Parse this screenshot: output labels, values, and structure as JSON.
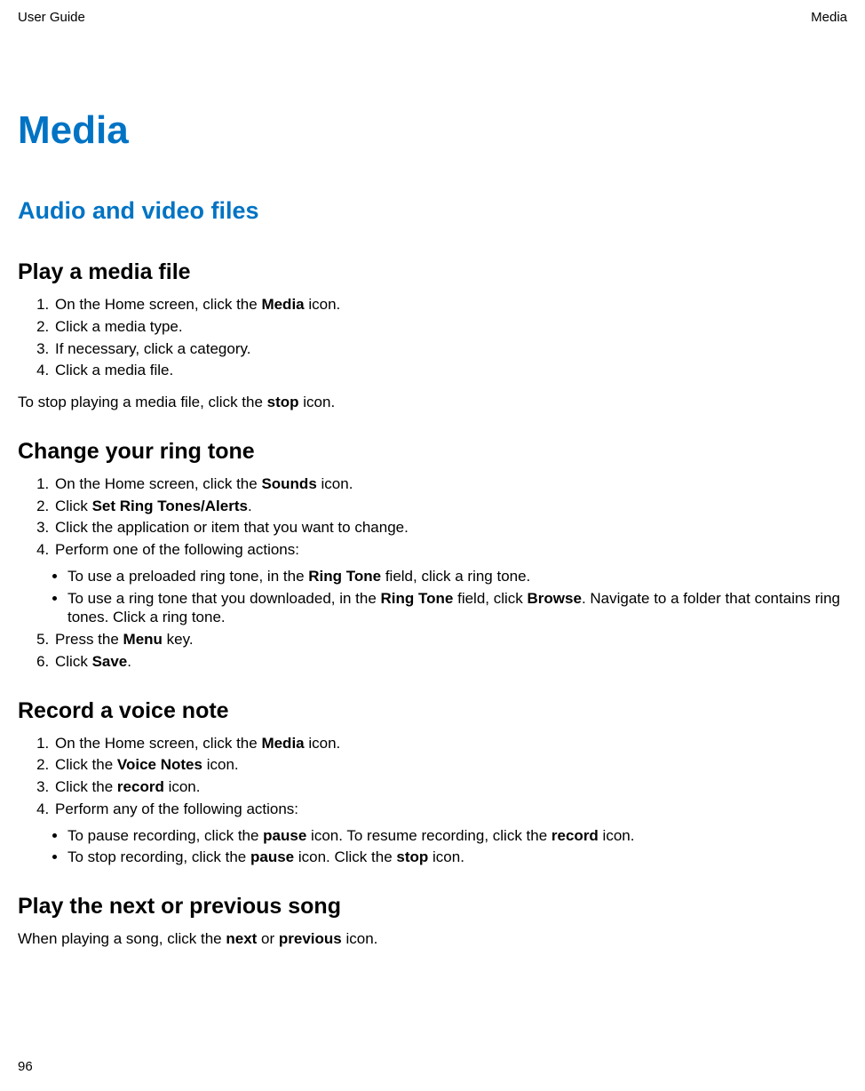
{
  "header": {
    "left": "User Guide",
    "right": "Media"
  },
  "title": "Media",
  "subtitle": "Audio and video files",
  "sections": {
    "play": {
      "heading": "Play a media file",
      "steps": [
        {
          "pre": "On the Home screen, click the ",
          "b": "Media",
          "post": " icon."
        },
        {
          "pre": "Click a media type.",
          "b": "",
          "post": ""
        },
        {
          "pre": "If necessary, click a category.",
          "b": "",
          "post": ""
        },
        {
          "pre": "Click a media file.",
          "b": "",
          "post": ""
        }
      ],
      "note": {
        "pre": "To stop playing a media file, click the ",
        "b": "stop",
        "post": " icon."
      }
    },
    "ring": {
      "heading": "Change your ring tone",
      "s1": {
        "pre": "On the Home screen, click the ",
        "b": "Sounds",
        "post": " icon."
      },
      "s2": {
        "pre": "Click ",
        "b": "Set Ring Tones/Alerts",
        "post": "."
      },
      "s3": "Click the application or item that you want to change.",
      "s4": "Perform one of the following actions:",
      "b1": {
        "pre": "To use a preloaded ring tone, in the ",
        "b": "Ring Tone",
        "post": " field, click a ring tone."
      },
      "b2": {
        "a": "To use a ring tone that you downloaded, in the ",
        "b": "Ring Tone",
        "c": " field, click ",
        "d": "Browse",
        "e": ". Navigate to a folder that contains ring tones. Click a ring tone."
      },
      "s5": {
        "pre": "Press the ",
        "b": "Menu",
        "post": " key."
      },
      "s6": {
        "pre": "Click ",
        "b": "Save",
        "post": "."
      }
    },
    "rec": {
      "heading": "Record a voice note",
      "s1": {
        "pre": "On the Home screen, click the ",
        "b": "Media",
        "post": " icon."
      },
      "s2": {
        "pre": "Click the ",
        "b": "Voice Notes",
        "post": " icon."
      },
      "s3": {
        "pre": "Click the ",
        "b": "record",
        "post": " icon."
      },
      "s4": "Perform any of the following actions:",
      "b1": {
        "a": "To pause recording, click the ",
        "b": "pause",
        "c": " icon. To resume recording, click the ",
        "d": "record",
        "e": " icon."
      },
      "b2": {
        "a": "To stop recording, click the ",
        "b": "pause",
        "c": " icon. Click the ",
        "d": "stop",
        "e": " icon."
      }
    },
    "next": {
      "heading": "Play the next or previous song",
      "p": {
        "a": "When playing a song, click the ",
        "b": "next",
        "c": " or ",
        "d": "previous",
        "e": " icon."
      }
    }
  },
  "pagenum": "96"
}
